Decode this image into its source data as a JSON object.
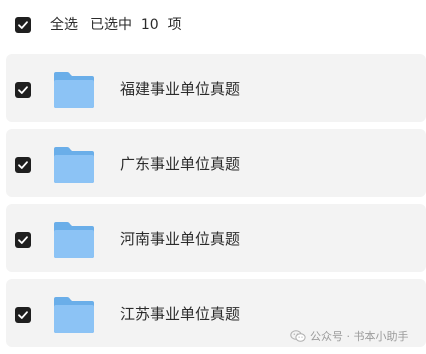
{
  "toolbar": {
    "select_all_label": "全选",
    "selected_text": "已选中  10  项",
    "checkbox_checked": true
  },
  "files": [
    {
      "name": "福建事业单位真题",
      "checked": true,
      "icon": "folder-icon"
    },
    {
      "name": "广东事业单位真题",
      "checked": true,
      "icon": "folder-icon"
    },
    {
      "name": "河南事业单位真题",
      "checked": true,
      "icon": "folder-icon"
    },
    {
      "name": "江苏事业单位真题",
      "checked": true,
      "icon": "folder-icon"
    }
  ],
  "watermark": {
    "text": "公众号 · 书本小助手",
    "icon": "wechat-icon"
  },
  "colors": {
    "checkbox": "#1f1f1f",
    "row_background": "#f3f3f3",
    "folder_front": "#8cc3f5",
    "folder_back": "#6aaee9"
  }
}
